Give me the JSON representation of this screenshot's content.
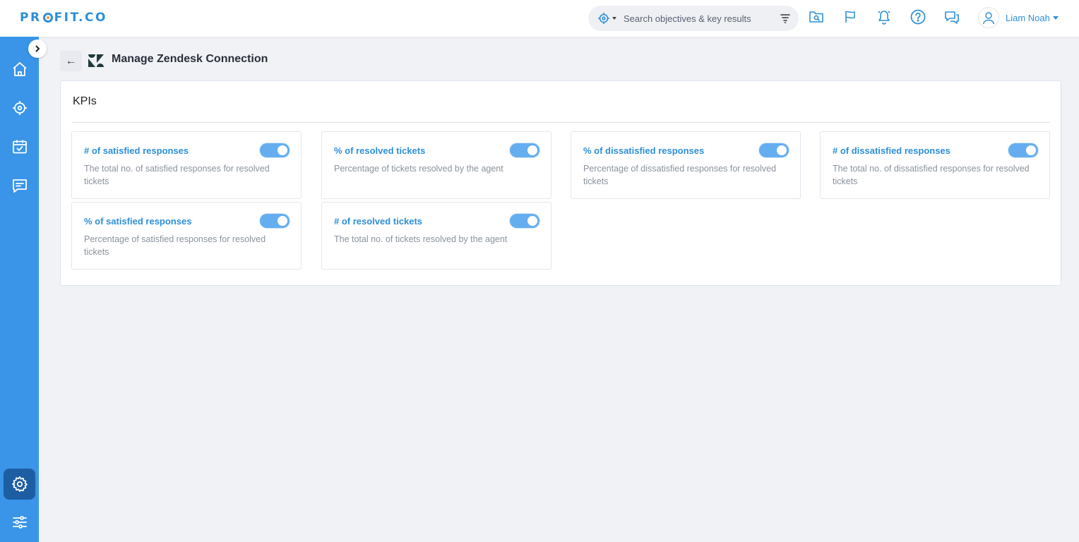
{
  "brand": {
    "logo_pre": "PR",
    "logo_post": "FIT.CO"
  },
  "search": {
    "placeholder": "Search objectives & key results"
  },
  "user": {
    "name": "Liam Noah"
  },
  "header": {
    "back_arrow": "←",
    "title": "Manage Zendesk Connection"
  },
  "panel": {
    "title": "KPIs",
    "cards": [
      {
        "title": "# of satisfied responses",
        "description": "The total no. of satisfied responses for resolved tickets",
        "enabled": true
      },
      {
        "title": "% of resolved tickets",
        "description": "Percentage of tickets resolved by the agent",
        "enabled": true
      },
      {
        "title": "% of dissatisfied responses",
        "description": "Percentage of dissatisfied responses for resolved tickets",
        "enabled": true
      },
      {
        "title": "# of dissatisfied responses",
        "description": "The total no. of dissatisfied responses for resolved tickets",
        "enabled": true
      },
      {
        "title": "% of satisfied responses",
        "description": "Percentage of satisfied responses for resolved tickets",
        "enabled": true
      },
      {
        "title": "# of resolved tickets",
        "description": "The total no. of tickets resolved by the agent",
        "enabled": true
      }
    ]
  },
  "icons": {
    "top": [
      "target-icon",
      "filter-icon",
      "folder-search-icon",
      "flag-icon",
      "bell-icon",
      "help-icon",
      "chat-icon",
      "user-avatar-icon"
    ],
    "sidebar": [
      "home-icon",
      "objectives-icon",
      "calendar-check-icon",
      "feedback-icon",
      "settings-icon",
      "sliders-icon"
    ]
  },
  "colors": {
    "accent": "#2d8fd8",
    "sidebar": "#3a95e8",
    "sidebar_active": "#1d5ea3",
    "toggle_on": "#64aef0"
  }
}
